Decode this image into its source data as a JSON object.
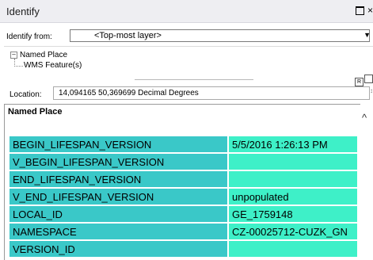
{
  "window": {
    "title": "Identify",
    "controls": {
      "restore_icon": "restore-icon",
      "close_glyph": "×"
    }
  },
  "identify_from": {
    "label": "Identify from:",
    "selected": "<Top-most layer>"
  },
  "tree": {
    "expander": "⊟",
    "layer": "Named Place",
    "feature": "WMS Feature(s)"
  },
  "splitter": {
    "btn1": "R",
    "btn2": ""
  },
  "location": {
    "label": "Location:",
    "value": "14,094165  50,369699 Decimal Degrees",
    "edge_mark": "↕"
  },
  "results": {
    "title": "Named Place",
    "rows": [
      {
        "field": "BEGIN_LIFESPAN_VERSION",
        "value": "5/5/2016 1:26:13 PM"
      },
      {
        "field": "V_BEGIN_LIFESPAN_VERSION",
        "value": ""
      },
      {
        "field": "END_LIFESPAN_VERSION",
        "value": ""
      },
      {
        "field": "V_END_LIFESPAN_VERSION",
        "value": "unpopulated"
      },
      {
        "field": "LOCAL_ID",
        "value": "GE_1759148"
      },
      {
        "field": "NAMESPACE",
        "value": "CZ-00025712-CUZK_GN"
      },
      {
        "field": "VERSION_ID",
        "value": ""
      }
    ]
  },
  "colors": {
    "field_bg": "#3ac8c8",
    "value_bg": "#3ef0c8",
    "titlebar_bg": "#eeeef2"
  }
}
